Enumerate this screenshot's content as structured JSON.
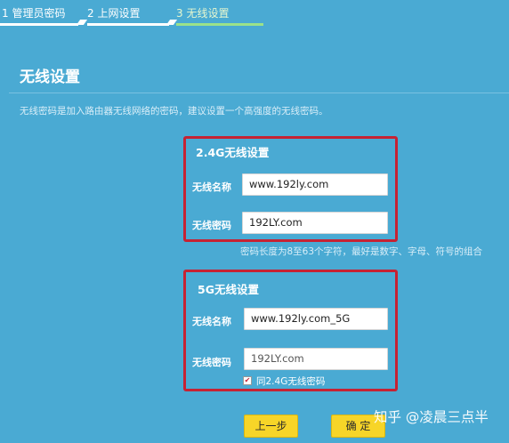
{
  "stepper": {
    "steps": [
      {
        "label": "1 管理员密码"
      },
      {
        "label": "2 上网设置"
      },
      {
        "label": "3 无线设置"
      }
    ]
  },
  "page": {
    "title": "无线设置",
    "description": "无线密码是加入路由器无线网络的密码，建议设置一个高强度的无线密码。"
  },
  "band24": {
    "title": "2.4G无线设置",
    "ssid_label": "无线名称",
    "ssid_value": "www.192ly.com",
    "password_label": "无线密码",
    "password_value": "192LY.com"
  },
  "hint": "密码长度为8至63个字符，最好是数字、字母、符号的组合",
  "band5": {
    "title": "5G无线设置",
    "ssid_label": "无线名称",
    "ssid_value": "www.192ly.com_5G",
    "password_label": "无线密码",
    "password_value": "192LY.com",
    "same_password_label": "同2.4G无线密码",
    "same_password_checked": true
  },
  "buttons": {
    "prev": "上一步",
    "ok": "确 定"
  },
  "watermark": "知乎 @凌晨三点半",
  "colors": {
    "background": "#4aaad3",
    "highlight_border": "#c62233",
    "button": "#f7d528",
    "active_step": "#9be28a"
  }
}
